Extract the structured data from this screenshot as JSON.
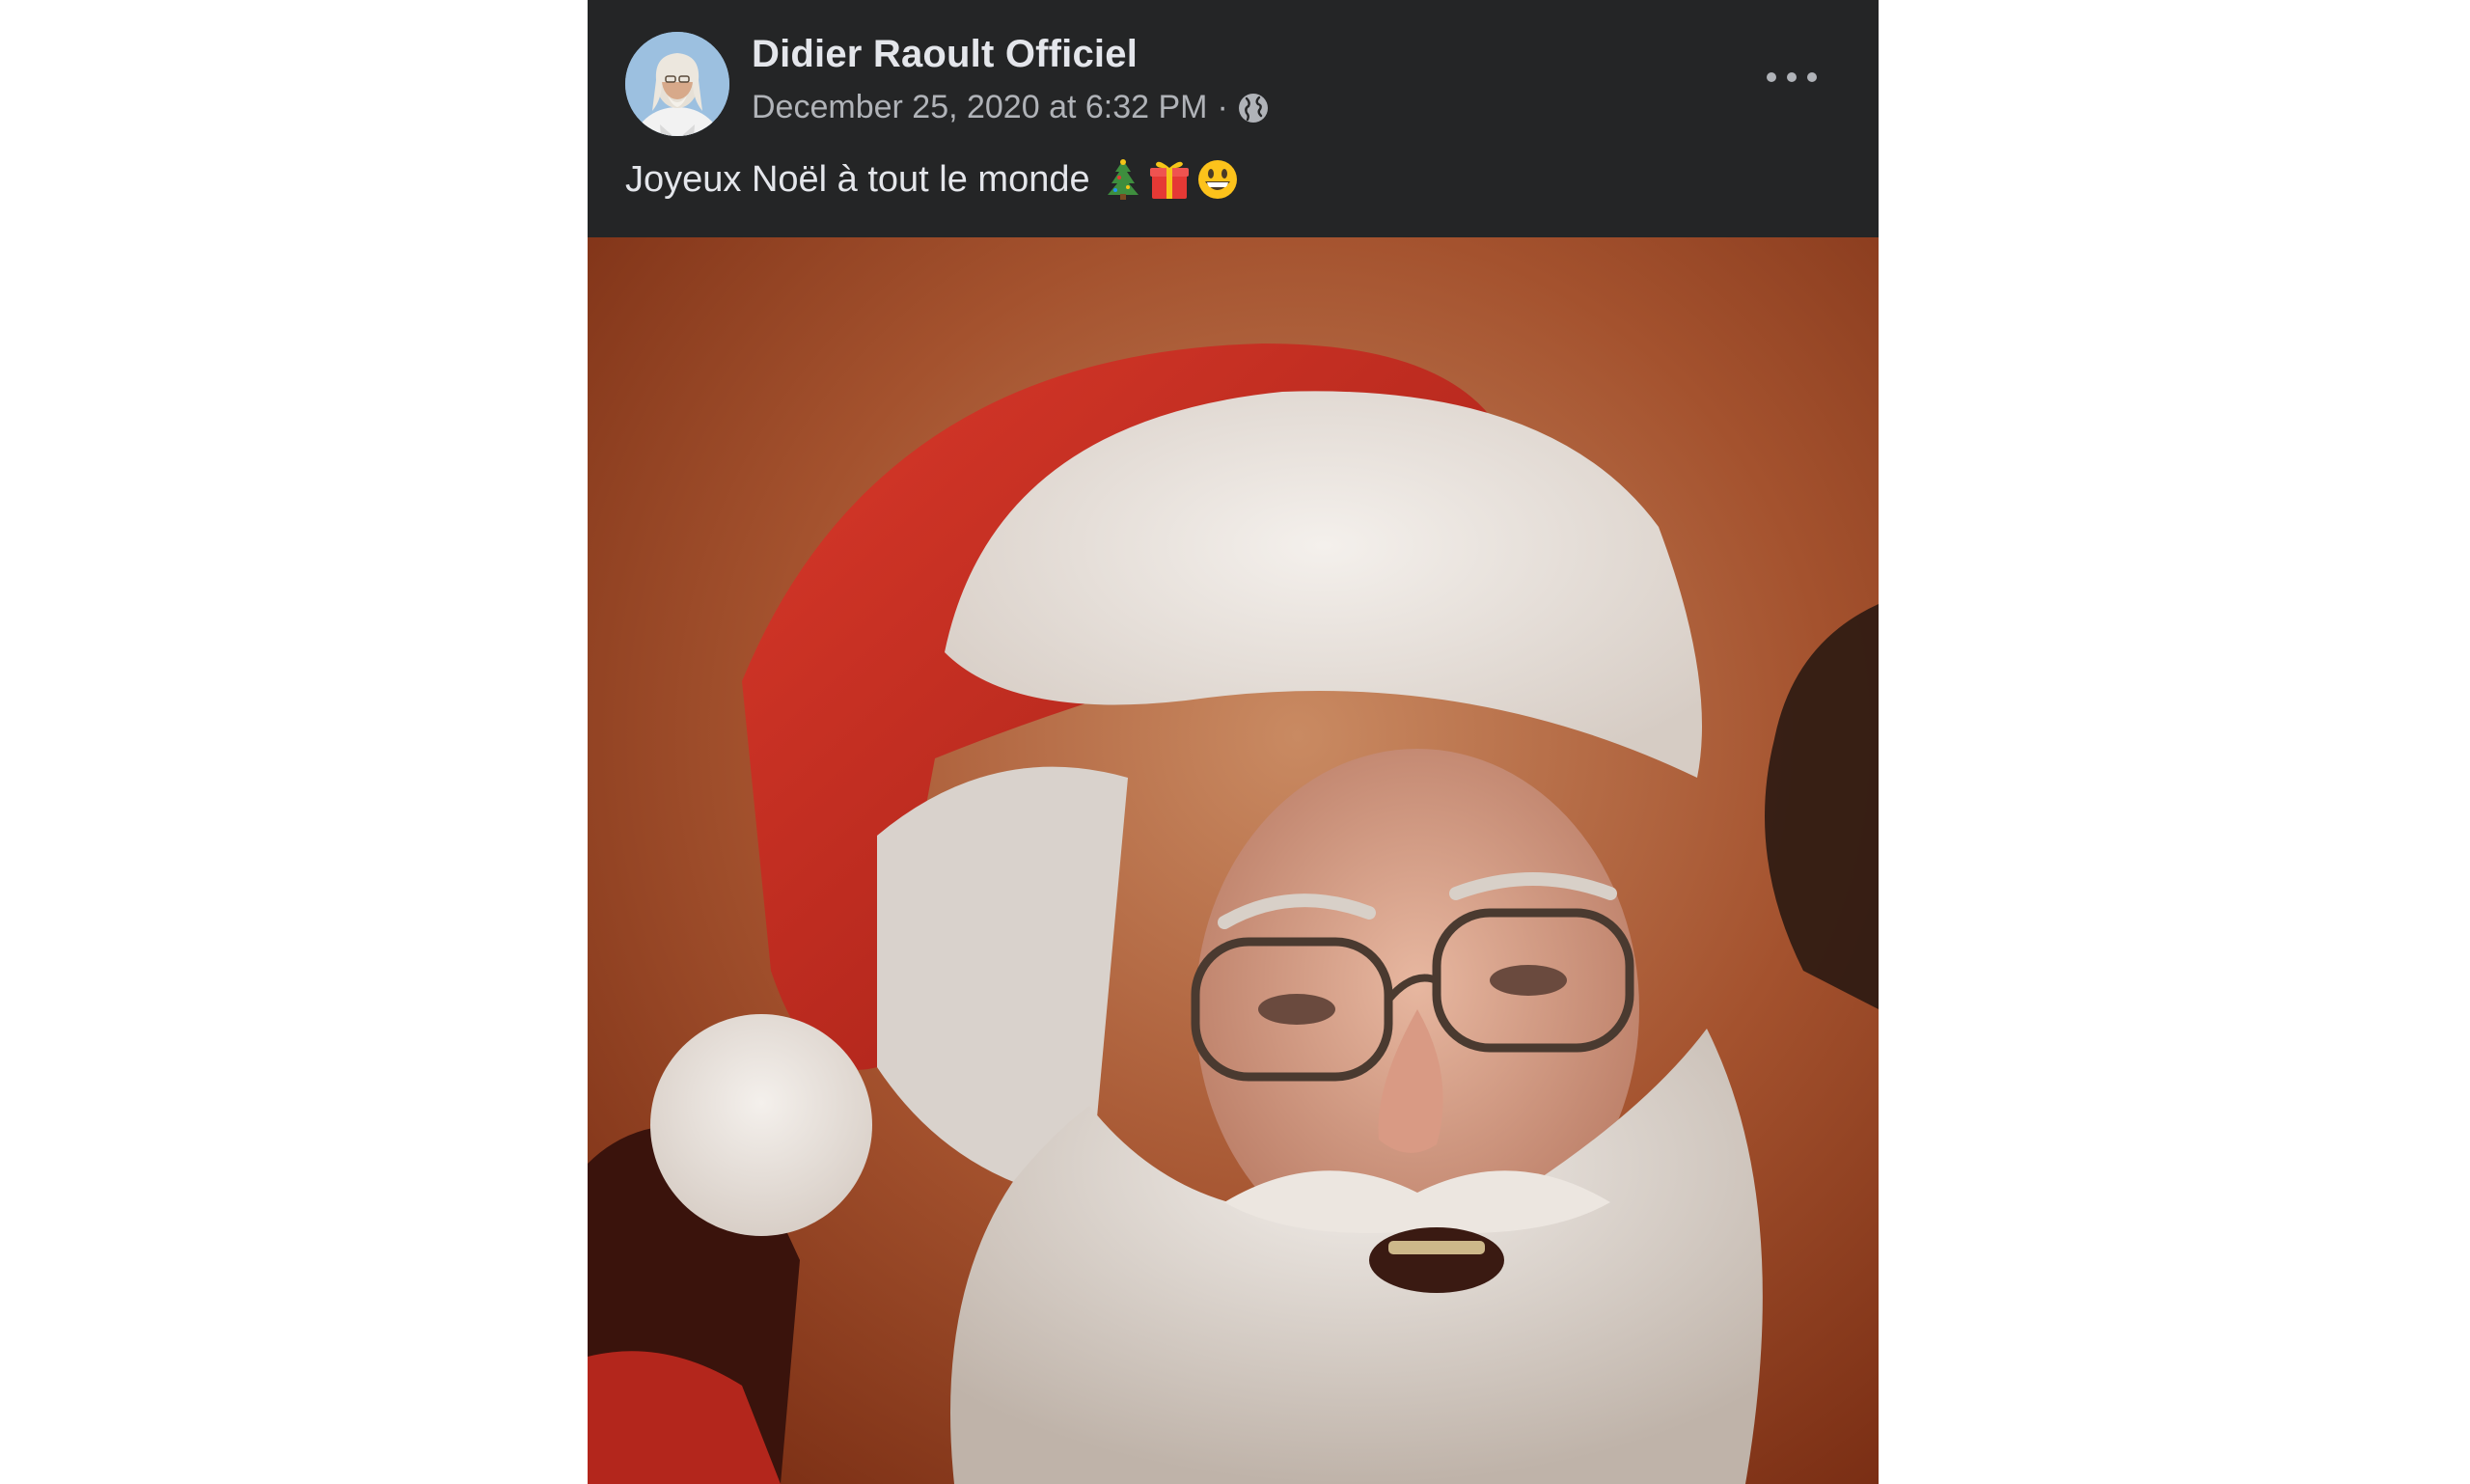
{
  "post": {
    "author": "Didier Raoult Officiel",
    "timestamp": "December 25, 2020 at 6:32 PM",
    "separator": "·",
    "audience_icon": "globe-icon",
    "text": "Joyeux Noël à tout le monde",
    "emojis": [
      "christmas-tree-icon",
      "gift-icon",
      "grinning-face-icon"
    ],
    "more_icon": "more-options-icon",
    "image": "santa-hat-portrait-photo"
  },
  "colors": {
    "card_background": "#242526",
    "primary_text": "#e4e6eb",
    "secondary_text": "#b0b3b8",
    "page_background": "#ffffff"
  }
}
